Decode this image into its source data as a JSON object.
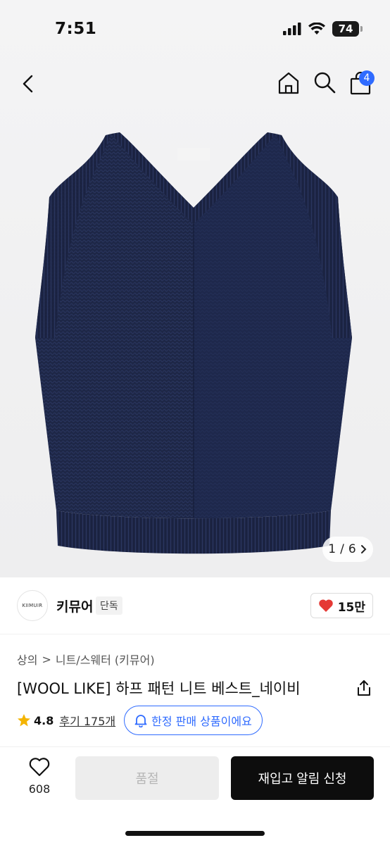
{
  "status_bar": {
    "time": "7:51",
    "battery": "74"
  },
  "nav": {
    "cart_count": "4"
  },
  "gallery": {
    "index": "1",
    "separator": "/",
    "total": "6"
  },
  "brand": {
    "logo_text": "KIIMUIR",
    "name": "키뮤어",
    "tag": "단독",
    "likes": "15만"
  },
  "breadcrumb": {
    "level1": "상의",
    "sep": ">",
    "level2": "니트/스웨터 (키뮤어)"
  },
  "product": {
    "title": "[WOOL LIKE] 하프 패턴 니트 베스트_네이비"
  },
  "rating": {
    "value": "4.8",
    "reviews": "후기 175개",
    "limited_notice": "한정 판매 상품이에요"
  },
  "bottom": {
    "wish_count": "608",
    "soldout_label": "품절",
    "restock_label": "재입고 알림 신청"
  },
  "colors": {
    "accent": "#2f6bff",
    "heart": "#e53935",
    "star": "#f4b400",
    "garment": "#1d2645"
  }
}
